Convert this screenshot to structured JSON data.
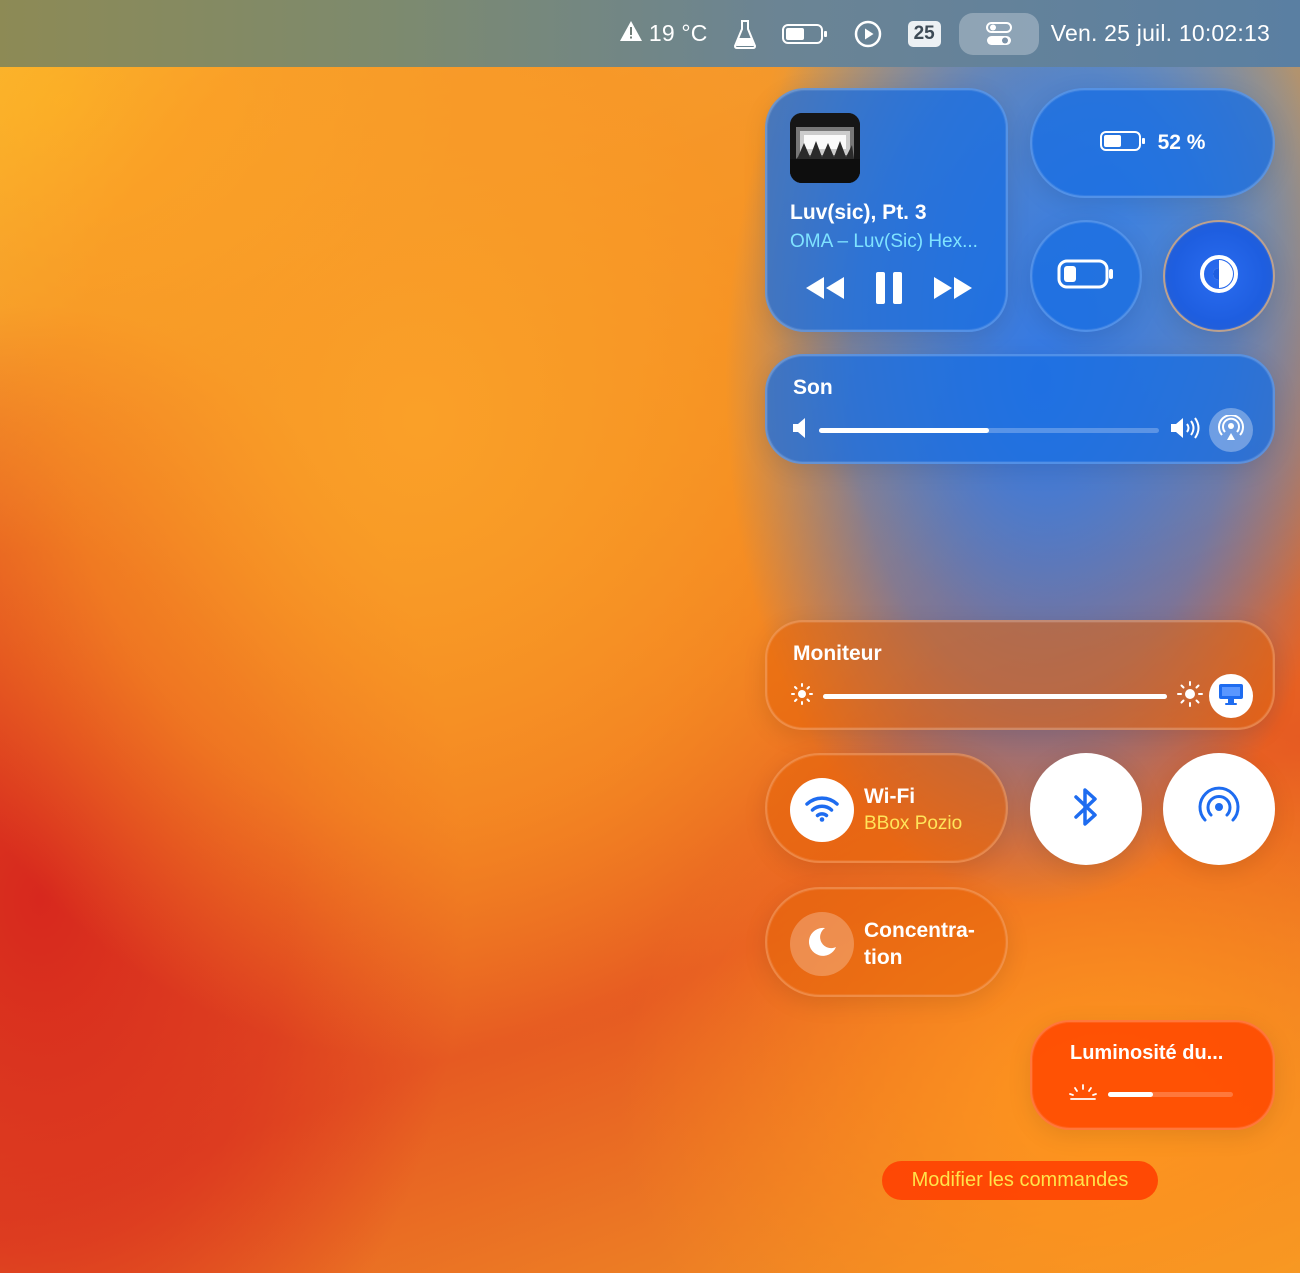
{
  "menubar": {
    "weather": "19 °C",
    "calendar_day": "25",
    "datetime": "Ven. 25 juil. 10:02:13",
    "icons": [
      "warning-icon",
      "flask-icon",
      "battery-icon",
      "play-circle-icon",
      "control-center-icon"
    ]
  },
  "media": {
    "title": "Luv(sic), Pt. 3",
    "artist": "OMA – Luv(Sic) Hex...",
    "state": "playing"
  },
  "battery": {
    "percent_label": "52 %",
    "level": 0.52
  },
  "sound": {
    "label": "Son",
    "level": 0.5
  },
  "monitor": {
    "label": "Moniteur",
    "level": 1.0
  },
  "wifi": {
    "label": "Wi-Fi",
    "network": "BBox Pozio"
  },
  "focus": {
    "label_line1": "Concentra-",
    "label_line2": "tion"
  },
  "keyboard": {
    "label": "Luminosité du...",
    "level": 0.36
  },
  "edit_button": "Modifier les commandes",
  "colors": {
    "accent_blue": "#1e6cf0",
    "artist_text": "#7fe3ff",
    "subtitle_yellow": "#ffe45a"
  }
}
